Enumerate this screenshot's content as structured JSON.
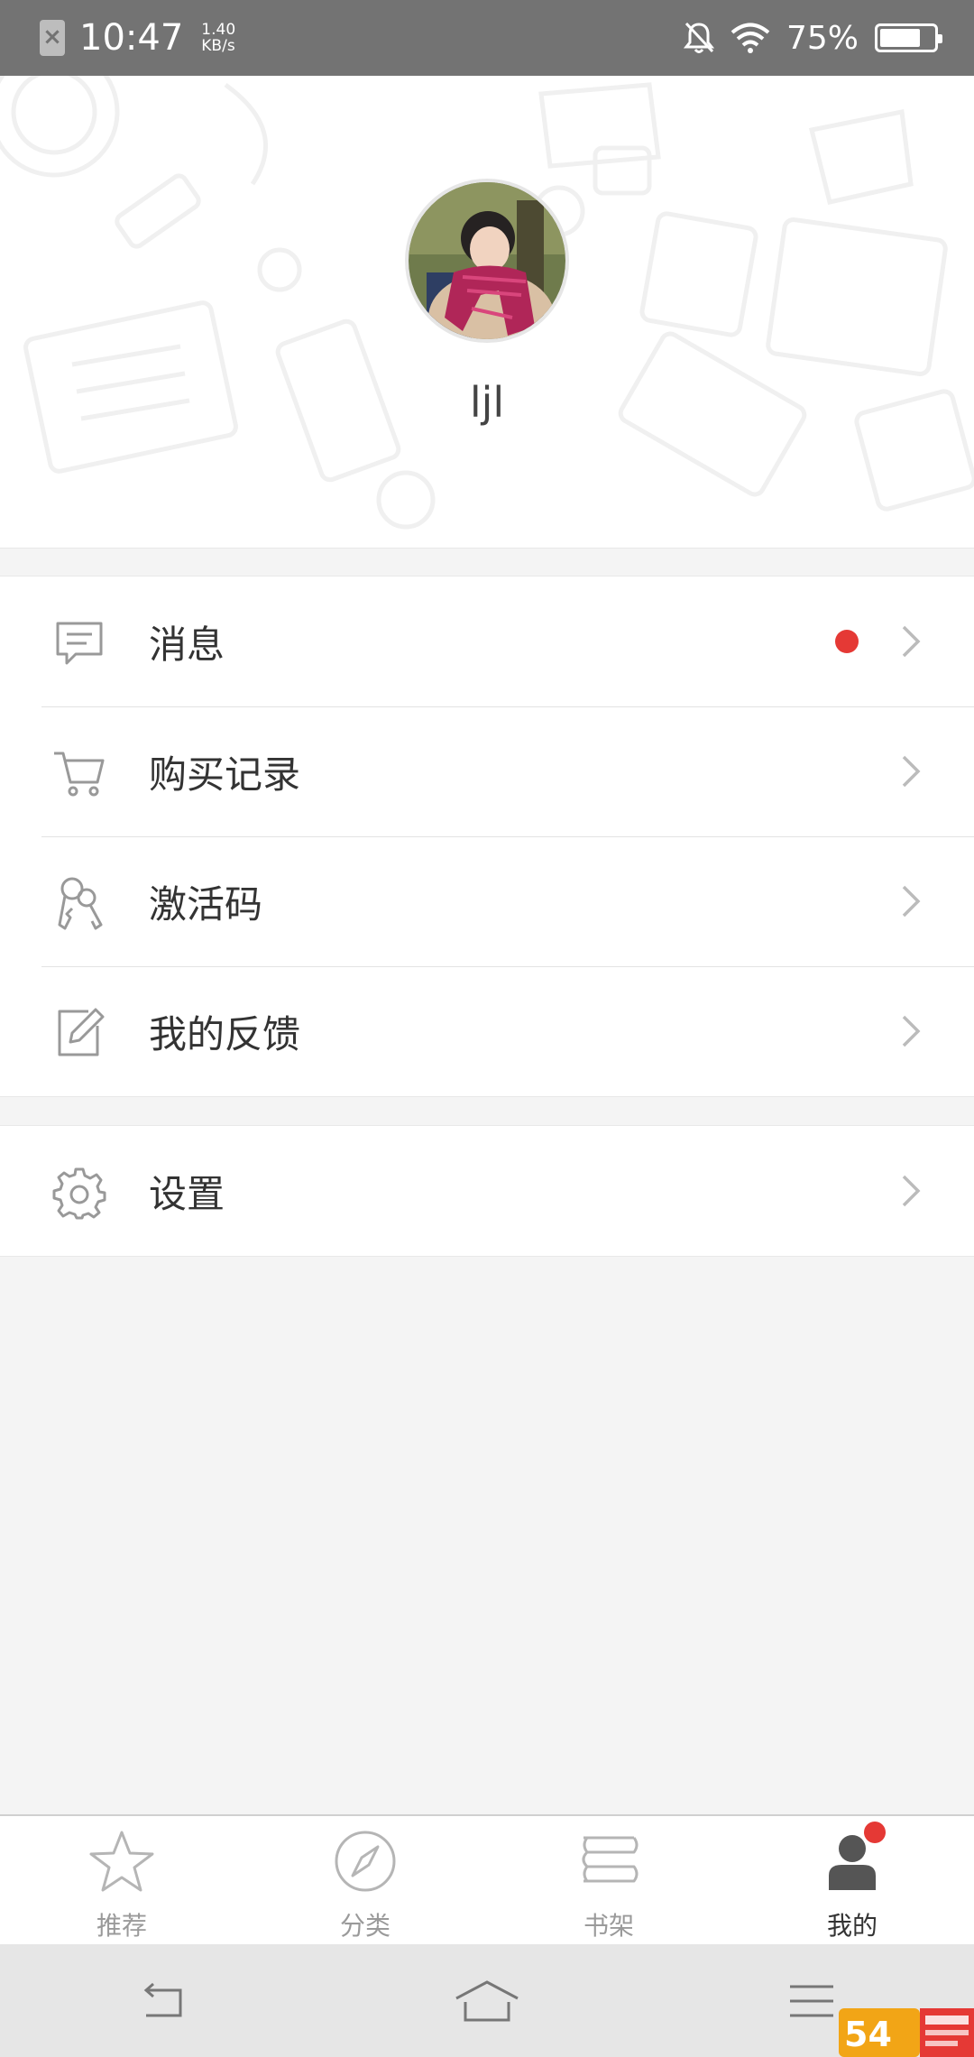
{
  "status_bar": {
    "time": "10:47",
    "net_speed_value": "1.40",
    "net_speed_unit": "KB/s",
    "battery_percent": "75%",
    "battery_level": 0.75
  },
  "profile": {
    "username": "ljl",
    "avatar_icon": "user-avatar-photo"
  },
  "menu": {
    "items": [
      {
        "label": "消息",
        "icon": "message-icon",
        "badge": true
      },
      {
        "label": "购买记录",
        "icon": "cart-icon",
        "badge": false
      },
      {
        "label": "激活码",
        "icon": "key-icon",
        "badge": false
      },
      {
        "label": "我的反馈",
        "icon": "edit-icon",
        "badge": false
      }
    ],
    "settings": {
      "label": "设置",
      "icon": "gear-icon"
    }
  },
  "bottom_nav": {
    "items": [
      {
        "label": "推荐",
        "icon": "star-icon"
      },
      {
        "label": "分类",
        "icon": "compass-icon"
      },
      {
        "label": "书架",
        "icon": "bookshelf-icon"
      },
      {
        "label": "我的",
        "icon": "user-icon",
        "active": true,
        "badge": true
      }
    ]
  },
  "colors": {
    "accent_red": "#e53935",
    "status_bar": "#737373",
    "background": "#f4f4f4"
  }
}
